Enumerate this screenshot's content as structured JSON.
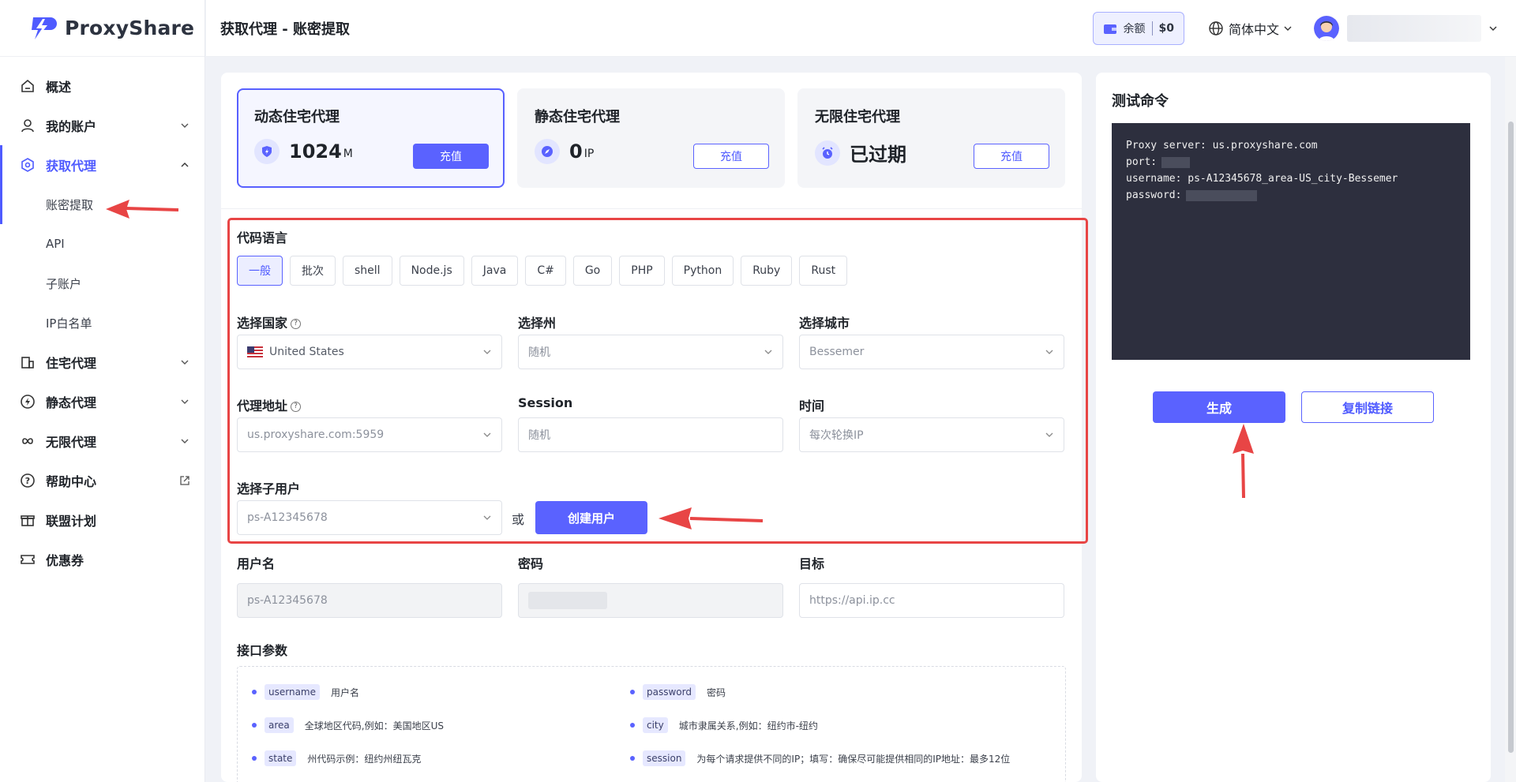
{
  "brand": {
    "name": "ProxyShare"
  },
  "header": {
    "title": "获取代理 - 账密提取",
    "balance_label": "余额",
    "balance_amount": "$0",
    "language": "简体中文"
  },
  "sidebar": {
    "items": [
      {
        "label": "概述",
        "icon": "home-icon"
      },
      {
        "label": "我的账户",
        "icon": "user-icon"
      },
      {
        "label": "获取代理",
        "icon": "target-icon"
      },
      {
        "label": "住宅代理",
        "icon": "building-icon"
      },
      {
        "label": "静态代理",
        "icon": "bolt-icon"
      },
      {
        "label": "无限代理",
        "icon": "infinity-icon"
      },
      {
        "label": "帮助中心",
        "icon": "help-icon"
      },
      {
        "label": "联盟计划",
        "icon": "gift-icon"
      },
      {
        "label": "优惠券",
        "icon": "ticket-icon"
      }
    ],
    "subitems": [
      {
        "label": "账密提取"
      },
      {
        "label": "API"
      },
      {
        "label": "子账户"
      },
      {
        "label": "IP白名单"
      }
    ]
  },
  "plans": [
    {
      "title": "动态住宅代理",
      "value": "1024",
      "unit": "M",
      "button": "充值",
      "icon": "shield-icon"
    },
    {
      "title": "静态住宅代理",
      "value": "0",
      "unit": "IP",
      "button": "充值",
      "icon": "compass-icon"
    },
    {
      "title": "无限住宅代理",
      "value": "已过期",
      "unit": "",
      "button": "充值",
      "icon": "alarm-icon"
    }
  ],
  "form": {
    "code_lang_label": "代码语言",
    "langs": [
      "一般",
      "批次",
      "shell",
      "Node.js",
      "Java",
      "C#",
      "Go",
      "PHP",
      "Python",
      "Ruby",
      "Rust"
    ],
    "country_label": "选择国家",
    "country_value": "United States",
    "state_label": "选择州",
    "state_value": "随机",
    "city_label": "选择城市",
    "city_value": "Bessemer",
    "proxy_label": "代理地址",
    "proxy_value": "us.proxyshare.com:5959",
    "session_label": "Session",
    "session_placeholder": "随机",
    "time_label": "时间",
    "time_value": "每次轮换IP",
    "subuser_label": "选择子用户",
    "subuser_value": "ps-A12345678",
    "or_text": "或",
    "create_user": "创建用户",
    "username_label": "用户名",
    "username_value": "ps-A12345678",
    "password_label": "密码",
    "target_label": "目标",
    "target_placeholder": "https://api.ip.cc"
  },
  "params": {
    "title": "接口参数",
    "items": [
      {
        "key": "username",
        "desc": "用户名"
      },
      {
        "key": "password",
        "desc": "密码"
      },
      {
        "key": "area",
        "desc": "全球地区代码,例如：美国地区US"
      },
      {
        "key": "city",
        "desc": "城市隶属关系,例如：纽约市-纽约"
      },
      {
        "key": "state",
        "desc": "州代码示例：纽约州纽瓦克"
      },
      {
        "key": "session",
        "desc": "为每个请求提供不同的IP；填写：确保尽可能提供相同的IP地址：最多12位"
      }
    ]
  },
  "test": {
    "title": "测试命令",
    "line1": "Proxy server: us.proxyshare.com",
    "line2": "port:",
    "line3": "username: ps-A12345678_area-US_city-Bessemer",
    "line4": "password:",
    "generate": "生成",
    "copy": "复制链接"
  },
  "colors": {
    "accent": "#5a62ff",
    "annotation": "#e84545"
  }
}
